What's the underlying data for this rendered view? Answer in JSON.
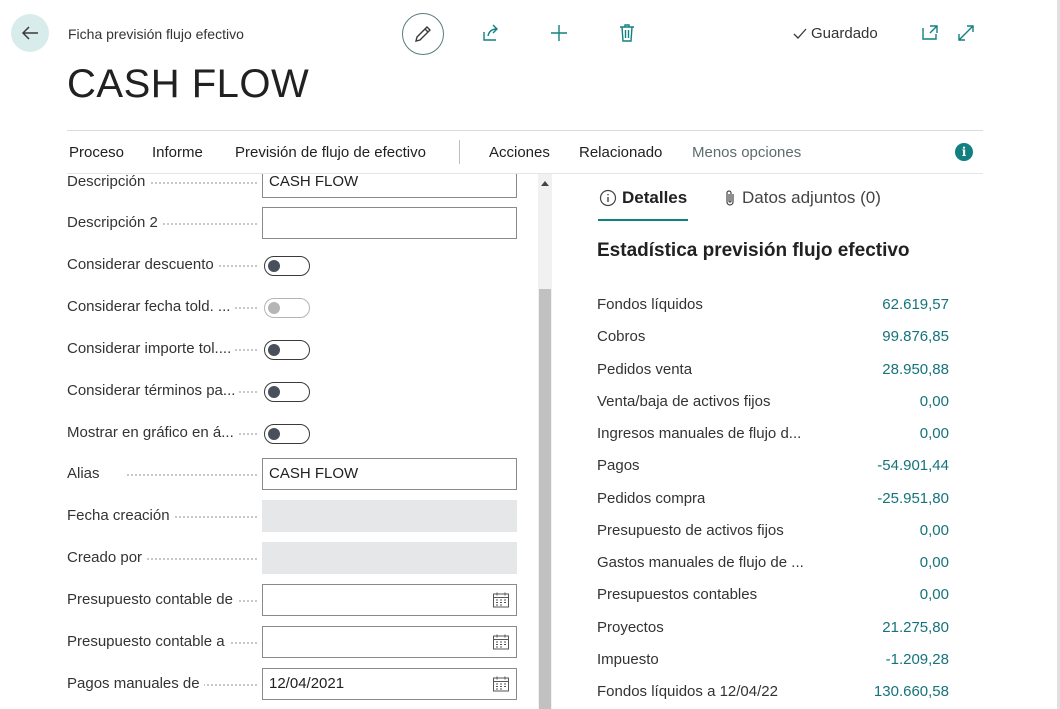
{
  "header": {
    "page_type": "Ficha previsión flujo efectivo",
    "title": "CASH FLOW",
    "saved_label": "Guardado"
  },
  "icons": {
    "back": "arrow-left-icon",
    "edit": "pencil-icon",
    "share": "share-icon",
    "add": "plus-icon",
    "delete": "trash-icon",
    "saved": "checkmark-icon",
    "open_new": "open-in-new-window-icon",
    "expand": "expand-icon",
    "info": "info-icon",
    "calendar": "calendar-icon",
    "attachment": "paperclip-icon"
  },
  "colors": {
    "accent": "#128080",
    "value_link": "#15737b",
    "readonly_bg": "#e6e7e8"
  },
  "menu": {
    "items": [
      "Proceso",
      "Informe",
      "Previsión de flujo de efectivo",
      "Acciones",
      "Relacionado",
      "Menos opciones"
    ],
    "info_symbol": "i"
  },
  "form": {
    "descripcion": {
      "label": "Descripción",
      "value": "CASH FLOW"
    },
    "descripcion2": {
      "label": "Descripción 2",
      "value": ""
    },
    "considerar_descuento": {
      "label": "Considerar descuento",
      "value": false
    },
    "considerar_fecha_told": {
      "label": "Considerar fecha told. ...",
      "value": false,
      "disabled": true
    },
    "considerar_importe_tol": {
      "label": "Considerar importe tol....",
      "value": false
    },
    "considerar_terminos": {
      "label": "Considerar términos pa...",
      "value": false
    },
    "mostrar_grafico": {
      "label": "Mostrar en gráfico en á...",
      "value": false
    },
    "alias": {
      "label": "Alias",
      "value": "CASH FLOW"
    },
    "fecha_creacion": {
      "label": "Fecha creación",
      "value": ""
    },
    "creado_por": {
      "label": "Creado por",
      "value": ""
    },
    "presupuesto_de": {
      "label": "Presupuesto contable de",
      "value": ""
    },
    "presupuesto_a": {
      "label": "Presupuesto contable a",
      "value": ""
    },
    "pagos_manuales_de": {
      "label": "Pagos manuales de",
      "value": "12/04/2021"
    }
  },
  "factbox": {
    "tabs": [
      "Detalles",
      "Datos adjuntos (0)"
    ],
    "title": "Estadística previsión flujo efectivo",
    "stats": [
      {
        "label": "Fondos líquidos",
        "value": "62.619,57"
      },
      {
        "label": "Cobros",
        "value": "99.876,85"
      },
      {
        "label": "Pedidos venta",
        "value": "28.950,88"
      },
      {
        "label": "Venta/baja de activos fijos",
        "value": "0,00"
      },
      {
        "label": "Ingresos manuales de flujo d...",
        "value": "0,00"
      },
      {
        "label": "Pagos",
        "value": "-54.901,44"
      },
      {
        "label": "Pedidos compra",
        "value": "-25.951,80"
      },
      {
        "label": "Presupuesto de activos fijos",
        "value": "0,00"
      },
      {
        "label": "Gastos manuales de flujo de ...",
        "value": "0,00"
      },
      {
        "label": "Presupuestos contables",
        "value": "0,00"
      },
      {
        "label": "Proyectos",
        "value": "21.275,80"
      },
      {
        "label": "Impuesto",
        "value": "-1.209,28"
      },
      {
        "label": "Fondos líquidos a 12/04/22",
        "value": "130.660,58"
      }
    ]
  }
}
